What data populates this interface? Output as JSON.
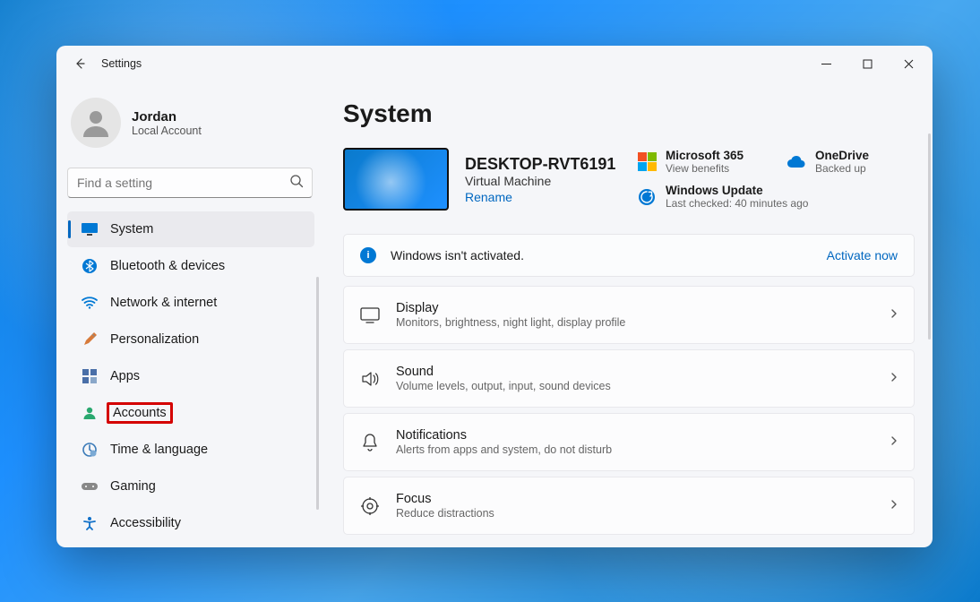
{
  "titlebar": {
    "title": "Settings"
  },
  "profile": {
    "name": "Jordan",
    "subtitle": "Local Account"
  },
  "search": {
    "placeholder": "Find a setting"
  },
  "nav": {
    "items": [
      {
        "label": "System",
        "icon": "monitor-icon",
        "active": true
      },
      {
        "label": "Bluetooth & devices",
        "icon": "bluetooth-icon"
      },
      {
        "label": "Network & internet",
        "icon": "wifi-icon"
      },
      {
        "label": "Personalization",
        "icon": "paintbrush-icon"
      },
      {
        "label": "Apps",
        "icon": "grid-icon"
      },
      {
        "label": "Accounts",
        "icon": "person-icon",
        "highlighted": true
      },
      {
        "label": "Time & language",
        "icon": "clock-globe-icon"
      },
      {
        "label": "Gaming",
        "icon": "gamepad-icon"
      },
      {
        "label": "Accessibility",
        "icon": "accessibility-icon"
      }
    ]
  },
  "page": {
    "title": "System"
  },
  "device": {
    "name": "DESKTOP-RVT6191",
    "type": "Virtual Machine",
    "rename": "Rename"
  },
  "quick": {
    "m365": {
      "title": "Microsoft 365",
      "subtitle": "View benefits"
    },
    "onedrive": {
      "title": "OneDrive",
      "subtitle": "Backed up"
    },
    "update": {
      "title": "Windows Update",
      "subtitle": "Last checked: 40 minutes ago"
    }
  },
  "banner": {
    "text": "Windows isn't activated.",
    "link": "Activate now"
  },
  "cards": [
    {
      "title": "Display",
      "subtitle": "Monitors, brightness, night light, display profile",
      "icon": "display-icon"
    },
    {
      "title": "Sound",
      "subtitle": "Volume levels, output, input, sound devices",
      "icon": "sound-icon"
    },
    {
      "title": "Notifications",
      "subtitle": "Alerts from apps and system, do not disturb",
      "icon": "bell-icon"
    },
    {
      "title": "Focus",
      "subtitle": "Reduce distractions",
      "icon": "focus-icon"
    }
  ]
}
